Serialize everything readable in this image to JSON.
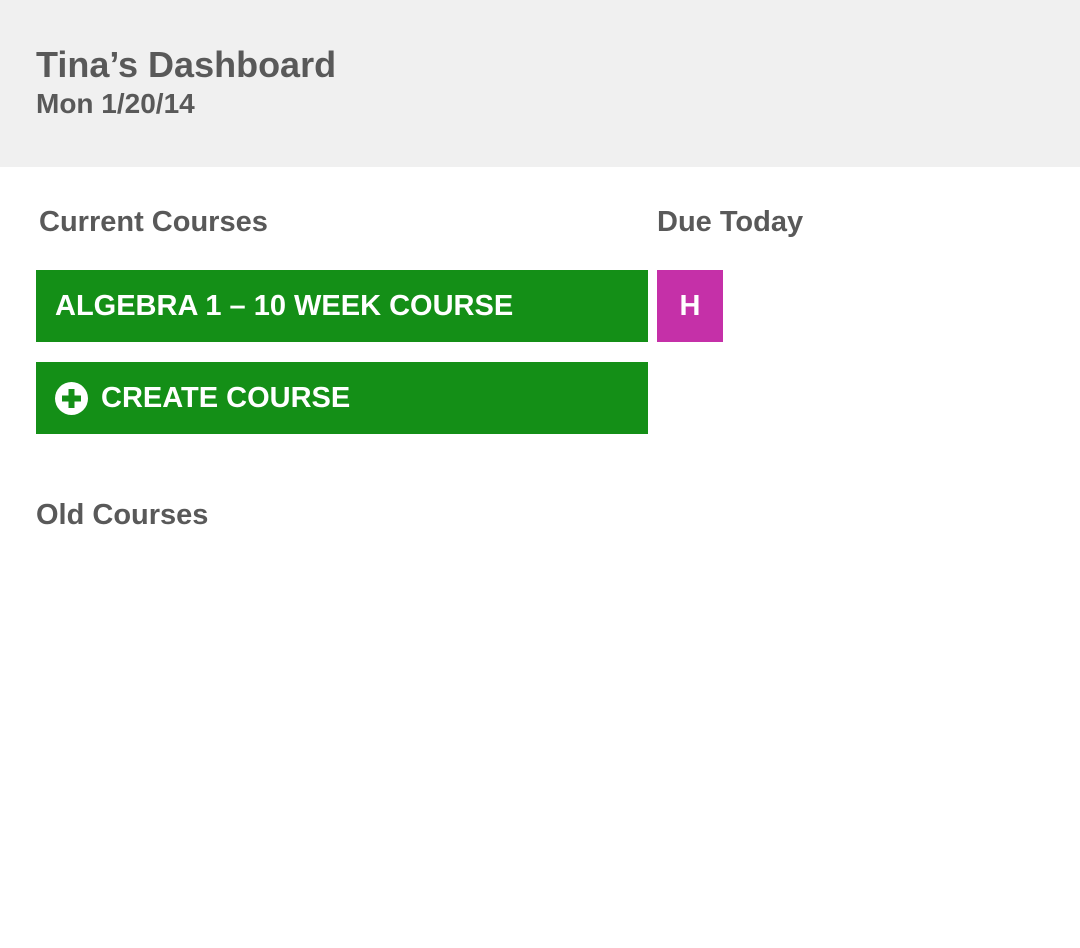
{
  "header": {
    "title": "Tina’s Dashboard",
    "date": "Mon 1/20/14"
  },
  "current_courses": {
    "heading": "Current Courses",
    "courses": [
      {
        "label": "ALGEBRA 1 – 10 WEEK COURSE"
      }
    ],
    "create_button": {
      "label": "CREATE COURSE",
      "icon": "plus-circle-icon"
    }
  },
  "due_today": {
    "heading": "Due Today",
    "items": [
      {
        "label": "H"
      }
    ]
  },
  "old_courses": {
    "heading": "Old Courses"
  },
  "colors": {
    "header_bg": "#f0f0f0",
    "text": "#595959",
    "course_green": "#148f17",
    "due_magenta": "#c530a8"
  }
}
